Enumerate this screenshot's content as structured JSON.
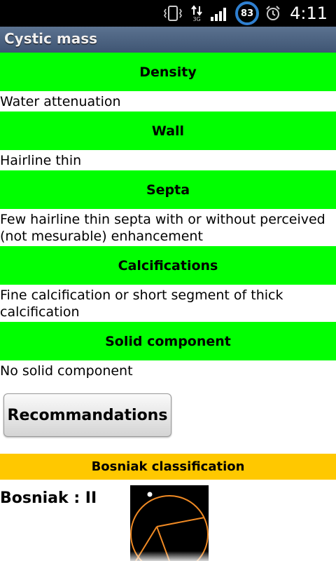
{
  "status_bar": {
    "network": "3G",
    "battery": "83",
    "time": "4:11"
  },
  "title": "Cystic mass",
  "sections": [
    {
      "header": "Density",
      "text": "Water attenuation"
    },
    {
      "header": "Wall",
      "text": "Hairline thin"
    },
    {
      "header": "Septa",
      "text": "Few hairline thin septa with or without perceived (not mesurable) enhancement"
    },
    {
      "header": "Calcifications",
      "text": "Fine calcification or short segment of thick calcification"
    },
    {
      "header": "Solid component",
      "text": "No solid component"
    }
  ],
  "recommendations_button": "Recommandations",
  "bosniak": {
    "header": "Bosniak classification",
    "value": "Bosniak : II"
  },
  "colors": {
    "section_header": "#00ff00",
    "bosniak_header": "#ffc800",
    "diagram_stroke": "#f08a24"
  }
}
